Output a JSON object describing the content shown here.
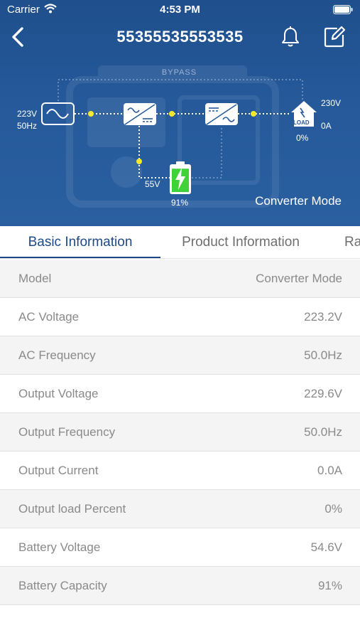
{
  "status_bar": {
    "carrier": "Carrier",
    "time": "4:53 PM"
  },
  "header": {
    "title": "55355535553535"
  },
  "flow": {
    "bypass_label": "BYPASS",
    "input_voltage": "223V",
    "input_frequency": "50Hz",
    "battery_voltage": "55V",
    "battery_percent": "91%",
    "load_badge": "LOAD",
    "output_voltage": "230V",
    "output_current": "0A",
    "load_percent": "0%",
    "mode": "Converter Mode",
    "battery_level": 0.91
  },
  "tabs": [
    {
      "label": "Basic Information",
      "active": true
    },
    {
      "label": "Product Information",
      "active": false
    },
    {
      "label": "Ra",
      "active": false
    }
  ],
  "info_rows": [
    {
      "label": "Model",
      "value": "Converter Mode"
    },
    {
      "label": "AC Voltage",
      "value": "223.2V"
    },
    {
      "label": "AC Frequency",
      "value": "50.0Hz"
    },
    {
      "label": "Output Voltage",
      "value": "229.6V"
    },
    {
      "label": "Output Frequency",
      "value": "50.0Hz"
    },
    {
      "label": "Output Current",
      "value": "0.0A"
    },
    {
      "label": "Output load Percent",
      "value": "0%"
    },
    {
      "label": "Battery Voltage",
      "value": "54.6V"
    },
    {
      "label": "Battery Capacity",
      "value": "91%"
    }
  ],
  "colors": {
    "header_bg": "#25599a",
    "accent": "#1d4a87",
    "battery_green": "#3fd23a",
    "flow_dot": "#f5ea2a"
  },
  "icons": {
    "back": "chevron-left-icon",
    "bell": "bell-icon",
    "edit": "edit-icon",
    "ac_source": "sine-wave-icon",
    "rectifier": "rectifier-icon",
    "inverter": "inverter-icon",
    "battery": "battery-charging-icon",
    "load": "load-house-icon"
  }
}
